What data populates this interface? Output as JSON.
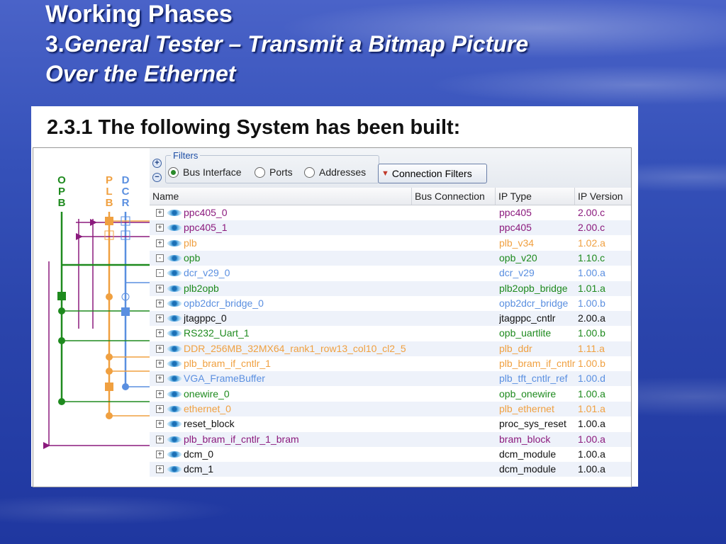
{
  "slide": {
    "title_line1": "Working Phases",
    "title_num": "3.",
    "title_rest": "General Tester – Transmit a Bitmap Picture",
    "title_line3": "Over the Ethernet",
    "section_heading": "2.3.1  The following System has been built:"
  },
  "bus_labels": {
    "opb": [
      "O",
      "P",
      "B"
    ],
    "plb": [
      "P",
      "L",
      "B"
    ],
    "dcr": [
      "D",
      "C",
      "R"
    ]
  },
  "filters": {
    "legend": "Filters",
    "options": [
      "Bus Interface",
      "Ports",
      "Addresses"
    ],
    "selected": "Bus Interface",
    "connection_button": "Connection Filters"
  },
  "columns": [
    "Name",
    "Bus Connection",
    "IP Type",
    "IP Version"
  ],
  "colors": {
    "purple": "#8b1a7d",
    "green": "#1e8a1e",
    "orange": "#f0a040",
    "blue": "#5a8fe0",
    "black": "#111111"
  },
  "rows": [
    {
      "expander": "+",
      "name": "ppc405_0",
      "ip_type": "ppc405",
      "version": "2.00.c",
      "color": "#8b1a7d"
    },
    {
      "expander": "+",
      "name": "ppc405_1",
      "ip_type": "ppc405",
      "version": "2.00.c",
      "color": "#8b1a7d"
    },
    {
      "expander": "+",
      "name": "plb",
      "ip_type": "plb_v34",
      "version": "1.02.a",
      "color": "#f0a040"
    },
    {
      "expander": "-",
      "name": "opb",
      "ip_type": "opb_v20",
      "version": "1.10.c",
      "color": "#1e8a1e"
    },
    {
      "expander": "-",
      "name": "dcr_v29_0",
      "ip_type": "dcr_v29",
      "version": "1.00.a",
      "color": "#5a8fe0"
    },
    {
      "expander": "+",
      "name": "plb2opb",
      "ip_type": "plb2opb_bridge",
      "version": "1.01.a",
      "color": "#1e8a1e"
    },
    {
      "expander": "+",
      "name": "opb2dcr_bridge_0",
      "ip_type": "opb2dcr_bridge",
      "version": "1.00.b",
      "color": "#5a8fe0"
    },
    {
      "expander": "+",
      "name": "jtagppc_0",
      "ip_type": "jtagppc_cntlr",
      "version": "2.00.a",
      "color": "#111111"
    },
    {
      "expander": "+",
      "name": "RS232_Uart_1",
      "ip_type": "opb_uartlite",
      "version": "1.00.b",
      "color": "#1e8a1e"
    },
    {
      "expander": "+",
      "name": "DDR_256MB_32MX64_rank1_row13_col10_cl2_5",
      "ip_type": "plb_ddr",
      "version": "1.11.a",
      "color": "#f0a040"
    },
    {
      "expander": "+",
      "name": "plb_bram_if_cntlr_1",
      "ip_type": "plb_bram_if_cntlr",
      "version": "1.00.b",
      "color": "#f0a040"
    },
    {
      "expander": "+",
      "name": "VGA_FrameBuffer",
      "ip_type": "plb_tft_cntlr_ref",
      "version": "1.00.d",
      "color": "#5a8fe0"
    },
    {
      "expander": "+",
      "name": "onewire_0",
      "ip_type": "opb_onewire",
      "version": "1.00.a",
      "color": "#1e8a1e"
    },
    {
      "expander": "+",
      "name": "ethernet_0",
      "ip_type": "plb_ethernet",
      "version": "1.01.a",
      "color": "#f0a040"
    },
    {
      "expander": "+",
      "name": "reset_block",
      "ip_type": "proc_sys_reset",
      "version": "1.00.a",
      "color": "#111111"
    },
    {
      "expander": "+",
      "name": "plb_bram_if_cntlr_1_bram",
      "ip_type": "bram_block",
      "version": "1.00.a",
      "color": "#8b1a7d"
    },
    {
      "expander": "+",
      "name": "dcm_0",
      "ip_type": "dcm_module",
      "version": "1.00.a",
      "color": "#111111"
    },
    {
      "expander": "+",
      "name": "dcm_1",
      "ip_type": "dcm_module",
      "version": "1.00.a",
      "color": "#111111"
    }
  ]
}
